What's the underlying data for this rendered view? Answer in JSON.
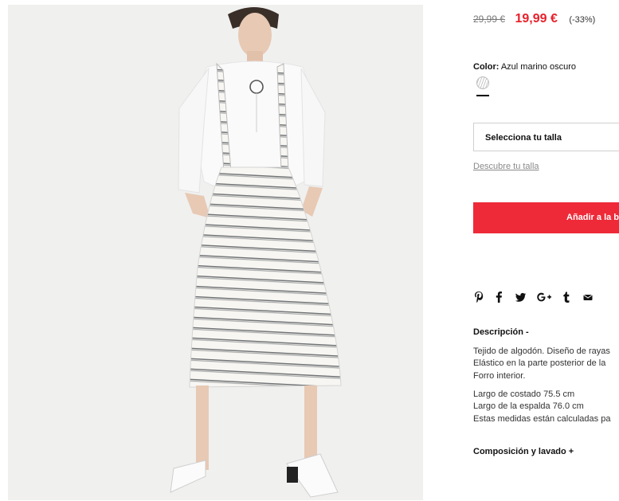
{
  "image": {
    "alt": "Model wearing white blouse and striped midi skirt with suspenders"
  },
  "price": {
    "old": "29,99 €",
    "current": "19,99 €",
    "discount": "(-33%)"
  },
  "color": {
    "label": "Color:",
    "value": "Azul marino oscuro"
  },
  "size": {
    "select_label": "Selecciona tu talla",
    "guide_link": "Descubre tu talla"
  },
  "cart": {
    "add_label": "Añadir a la b"
  },
  "share": {
    "icons": [
      "pinterest-icon",
      "facebook-icon",
      "twitter-icon",
      "google-plus-icon",
      "tumblr-icon",
      "email-icon"
    ]
  },
  "description": {
    "title": "Descripción -",
    "lines": [
      "Tejido de algodón. Diseño de rayas",
      "Elástico en la parte posterior de la",
      "Forro interior."
    ],
    "measures": [
      "Largo de costado 75.5 cm",
      "Largo de la espalda 76.0 cm",
      "Estas medidas están calculadas pa"
    ]
  },
  "composition": {
    "title": "Composición y lavado +"
  },
  "colors": {
    "accent": "#ee2a38",
    "price": "#e8202a"
  }
}
